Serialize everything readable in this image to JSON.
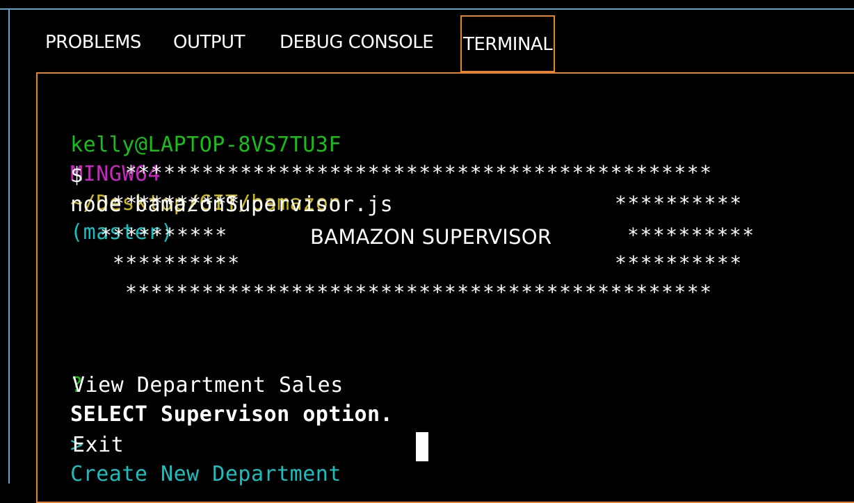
{
  "tabs": [
    {
      "label": "PROBLEMS",
      "active": false
    },
    {
      "label": "OUTPUT",
      "active": false
    },
    {
      "label": "DEBUG CONSOLE",
      "active": false
    },
    {
      "label": "TERMINAL",
      "active": true
    }
  ],
  "colors": {
    "frame": "#5ea6c9",
    "active_border": "#e8832e",
    "user": "#17bf17",
    "shell": "#c928c0",
    "path": "#c9b624",
    "branch": "#19bfbf"
  },
  "terminal": {
    "prompt": {
      "user": "kelly@LAPTOP-8VS7TU3F",
      "shell": "MINGW64",
      "path": "~/Desktop/GIT/bamazon",
      "branch": "(master)"
    },
    "command": {
      "symbol": "$",
      "text": "node bamazonSupervisor.js"
    },
    "banner": {
      "row1": "**********************************************",
      "row2_left": "**********",
      "row2_right": "**********",
      "row3_left": "**********",
      "title": "BAMAZON SUPERVISOR",
      "row3_right": "**********",
      "row4_left": "**********",
      "row4_right": "**********",
      "row5": "**********************************************"
    },
    "question": {
      "marker": "?",
      "text": "SELECT Supervison option."
    },
    "options": [
      {
        "label": "View Department Sales",
        "selected": false
      },
      {
        "label": "Create New Department",
        "selected": true,
        "pointer": ">"
      },
      {
        "label": "Exit",
        "selected": false
      }
    ]
  }
}
